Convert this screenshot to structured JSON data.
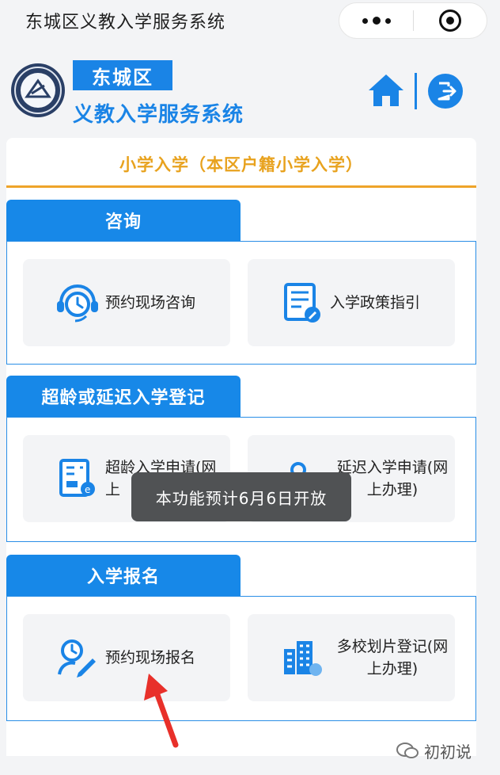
{
  "window": {
    "title": "东城区义教入学服务系统"
  },
  "header": {
    "badge": "东城区",
    "subtitle": "义教入学服务系统"
  },
  "page": {
    "section_title": "小学入学（本区户籍小学入学）"
  },
  "groups": [
    {
      "title": "咨询",
      "items": [
        {
          "label": "预约现场咨询",
          "icon": "consult-headset-icon"
        },
        {
          "label": "入学政策指引",
          "icon": "policy-document-icon"
        }
      ]
    },
    {
      "title": "超龄或延迟入学登记",
      "items": [
        {
          "label": "超龄入学申请(网上",
          "icon": "over-age-form-icon"
        },
        {
          "label": "延迟入学申请(网上办理)",
          "icon": "delay-user-icon"
        }
      ]
    },
    {
      "title": "入学报名",
      "items": [
        {
          "label": "预约现场报名",
          "icon": "register-clock-pen-icon"
        },
        {
          "label": "多校划片登记(网上办理)",
          "icon": "building-icon"
        }
      ]
    }
  ],
  "toast": {
    "message": "本功能预计6月6日开放"
  },
  "watermark": {
    "text": "初初说"
  },
  "colors": {
    "primary": "#1a84e6",
    "accent": "#eea42a",
    "arrow": "#e8302a"
  }
}
